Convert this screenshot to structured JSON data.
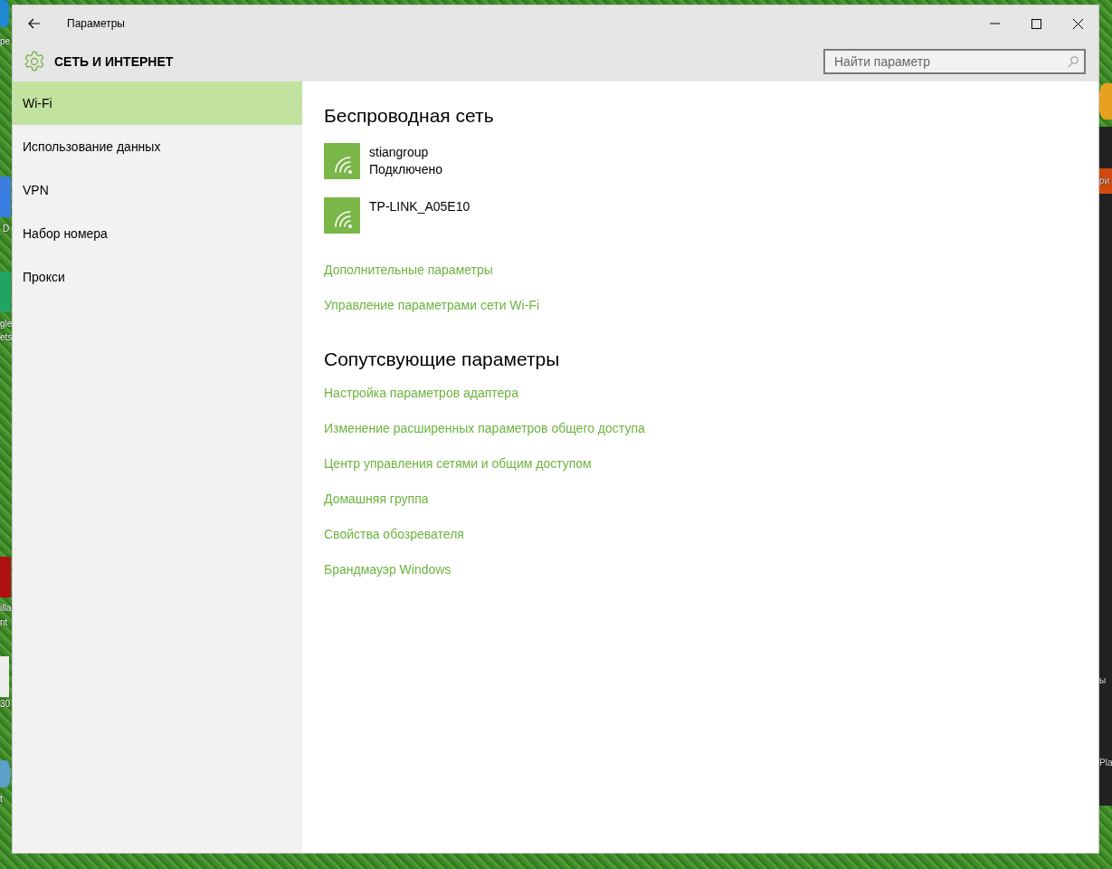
{
  "desktop": {
    "left_labels": [
      "pe",
      "D",
      "gle",
      "ets",
      "illa",
      "nt",
      "30",
      "t"
    ],
    "right_labels": [
      "ри",
      "ы",
      "Pla"
    ]
  },
  "window": {
    "title": "Параметры",
    "section_title": "СЕТЬ И ИНТЕРНЕТ",
    "search": {
      "placeholder": "Найти параметр"
    }
  },
  "sidebar": {
    "items": [
      {
        "label": "Wi-Fi",
        "selected": true
      },
      {
        "label": "Использование данных",
        "selected": false
      },
      {
        "label": "VPN",
        "selected": false
      },
      {
        "label": "Набор номера",
        "selected": false
      },
      {
        "label": "Прокси",
        "selected": false
      }
    ]
  },
  "wireless": {
    "heading": "Беспроводная сеть",
    "networks": [
      {
        "name": "stiangroup",
        "status": "Подключено"
      },
      {
        "name": "TP-LINK_A05E10"
      }
    ],
    "links": [
      "Дополнительные параметры",
      "Управление параметрами сети Wi-Fi"
    ]
  },
  "related": {
    "heading": "Сопутсвующие параметры",
    "links": [
      "Настройка параметров адаптера",
      "Изменение расширенных параметров общего доступа",
      "Центр управления сетями и общим доступом",
      "Домашняя группа",
      "Свойства обозревателя",
      "Брандмауэр Windows"
    ]
  }
}
